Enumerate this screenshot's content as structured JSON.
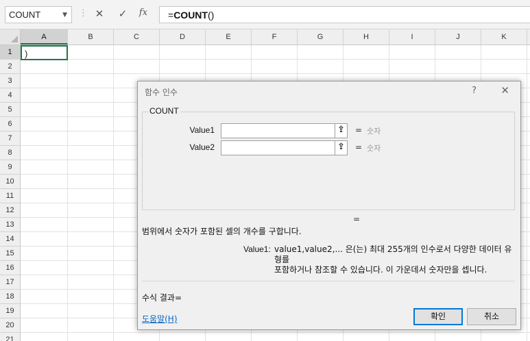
{
  "formula_bar": {
    "name_box": "COUNT",
    "cancel_glyph": "✕",
    "enter_glyph": "✓",
    "fx_glyph": "fx",
    "formula_prefix": "=",
    "formula_function": "COUNT",
    "formula_suffix": "()"
  },
  "grid": {
    "columns": [
      "A",
      "B",
      "C",
      "D",
      "E",
      "F",
      "G",
      "H",
      "I",
      "J",
      "K"
    ],
    "rows": [
      "1",
      "2",
      "3",
      "4",
      "5",
      "6",
      "7",
      "8",
      "9",
      "10",
      "11",
      "12",
      "13",
      "14",
      "15",
      "16",
      "17",
      "18",
      "19",
      "20",
      "21"
    ],
    "active_cell_content": ")",
    "selection_color": "#217346"
  },
  "dialog": {
    "title": "함수 인수",
    "help_glyph": "?",
    "close_glyph": "✕",
    "function_name": "COUNT",
    "arguments": [
      {
        "label": "Value1",
        "value": "",
        "equals": "=",
        "type_hint": "숫자"
      },
      {
        "label": "Value2",
        "value": "",
        "equals": "=",
        "type_hint": "숫자"
      }
    ],
    "result_equals": "=",
    "description": "범위에서 숫자가 포함된 셀의 개수를 구합니다.",
    "arg_description_label": "Value1:",
    "arg_description_line1": "value1,value2,... 은(는) 최대 255개의 인수로서 다양한 데이터 유형를",
    "arg_description_line2": "포함하거나 참조할 수 있습니다. 이 가운데서 숫자만을 셉니다.",
    "formula_result_label": "수식 결과=",
    "help_link": "도움말(H)",
    "ok_label": "확인",
    "cancel_label": "취소",
    "accent_color": "#0078d7"
  }
}
